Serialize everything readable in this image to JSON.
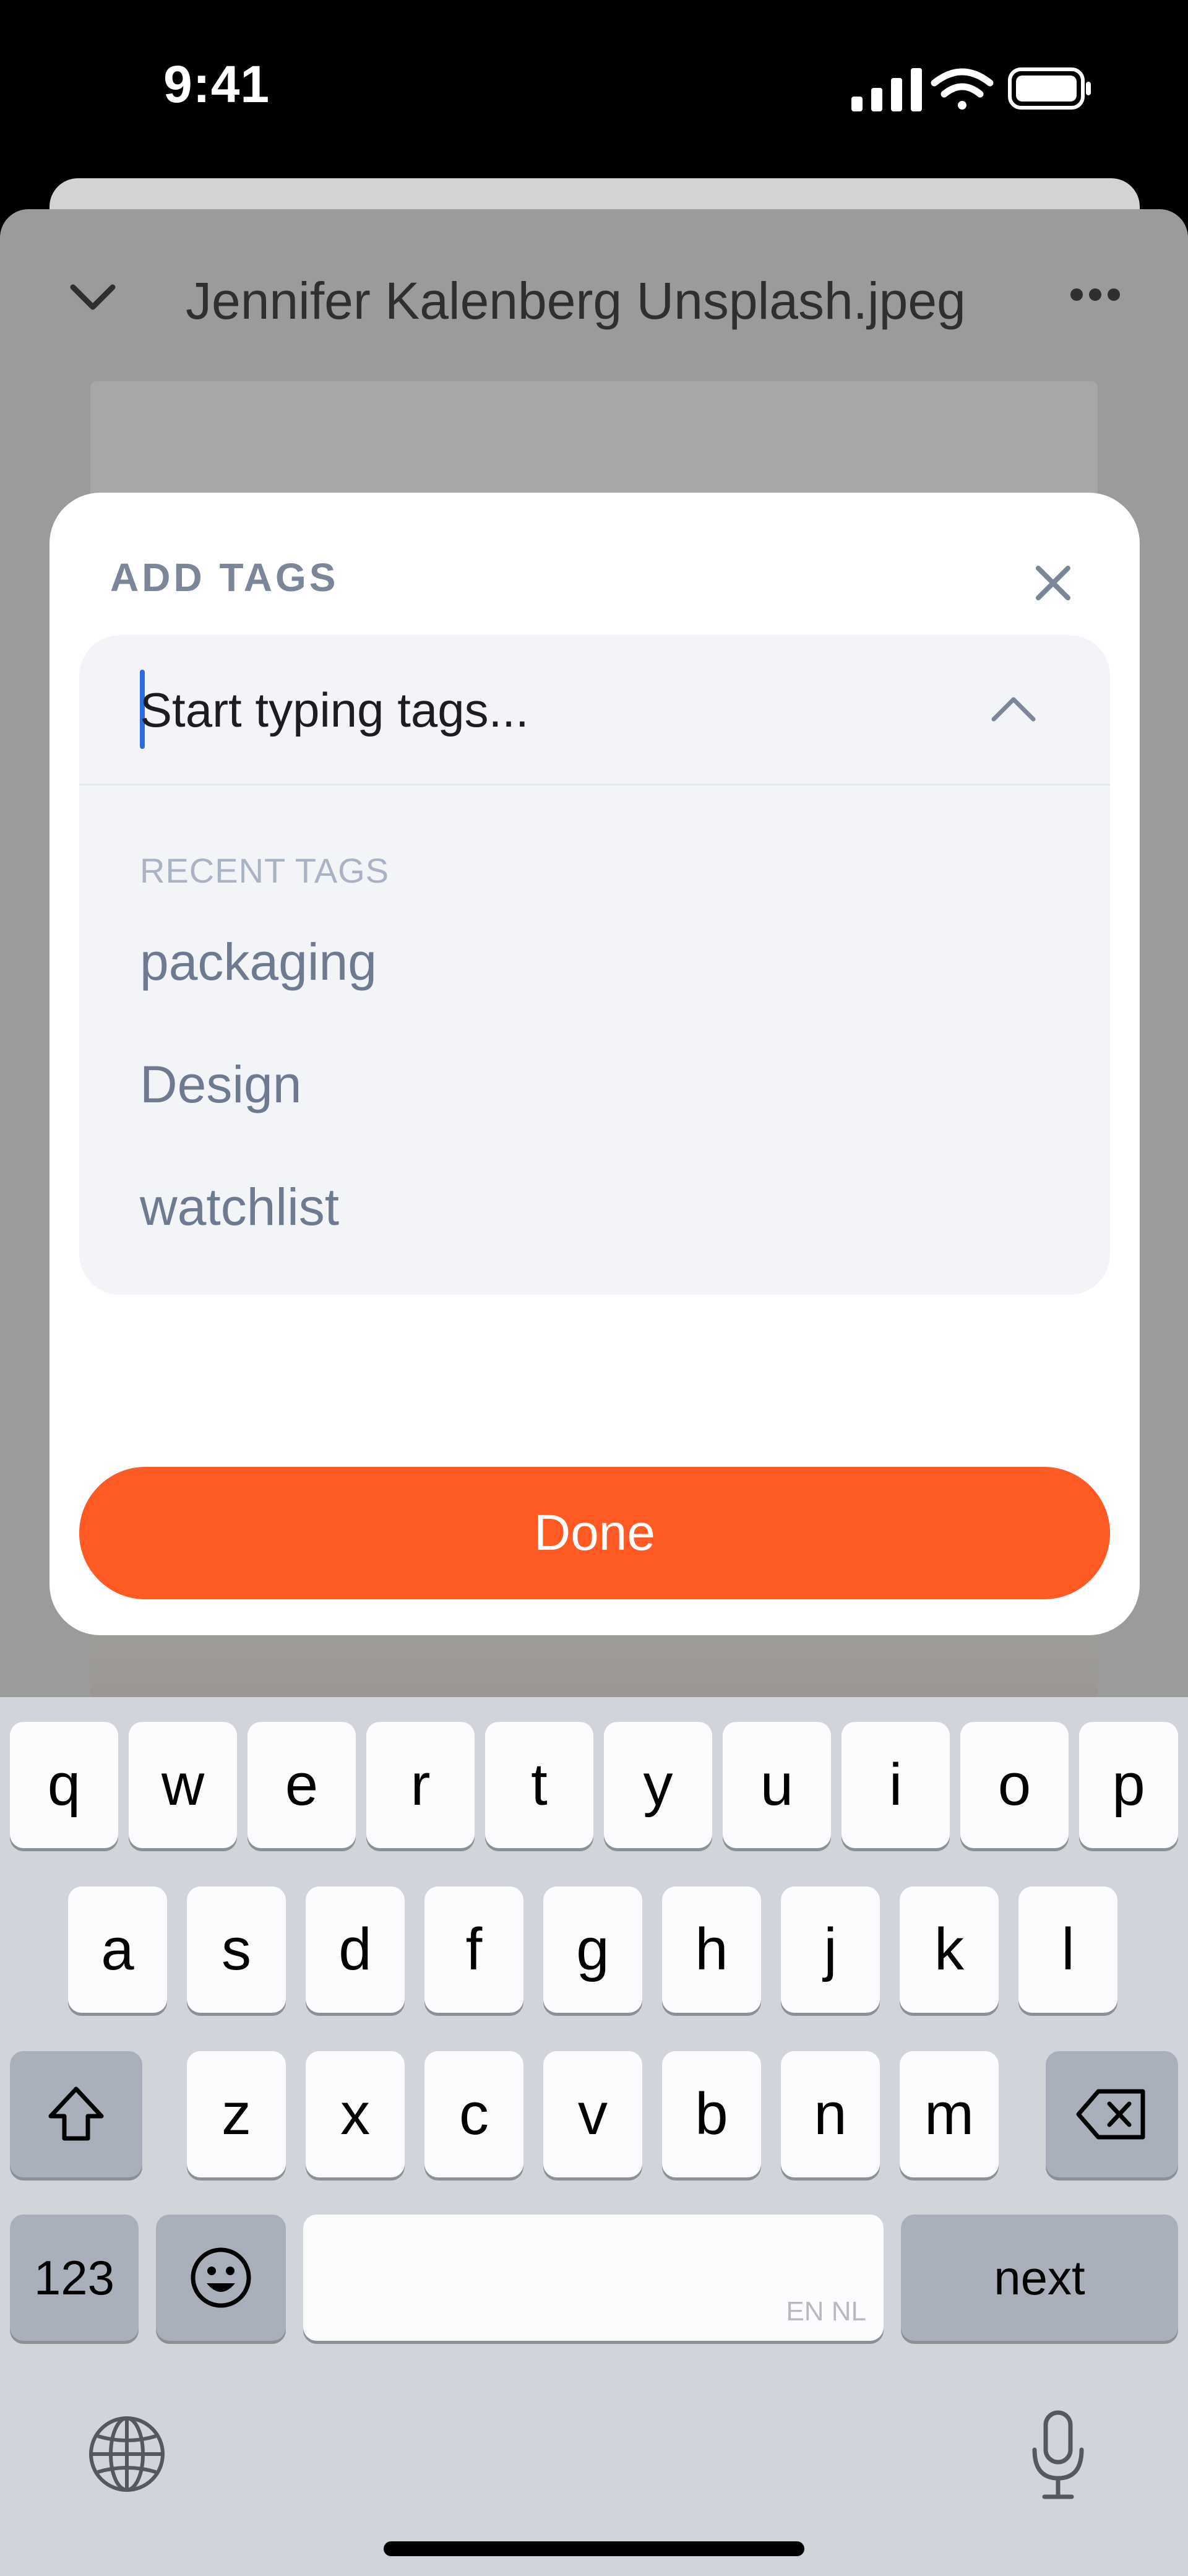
{
  "status_bar": {
    "time": "9:41",
    "signal_icon": "cellular-signal-icon",
    "wifi_icon": "wifi-icon",
    "battery_icon": "battery-icon"
  },
  "sheet": {
    "title": "Jennifer Kalenberg Unsplash.jpeg",
    "collapse_icon": "chevron-down-icon",
    "more_icon": "ellipsis-icon"
  },
  "modal": {
    "title": "ADD TAGS",
    "close_icon": "close-icon",
    "input": {
      "placeholder": "Start typing tags...",
      "value": ""
    },
    "dropdown_icon": "chevron-up-icon",
    "recent_heading": "RECENT TAGS",
    "recent_tags": [
      "packaging",
      "Design",
      "watchlist"
    ],
    "done_label": "Done",
    "accent_color": "#FF5A24"
  },
  "keyboard": {
    "row1": [
      "q",
      "w",
      "e",
      "r",
      "t",
      "y",
      "u",
      "i",
      "o",
      "p"
    ],
    "row2": [
      "a",
      "s",
      "d",
      "f",
      "g",
      "h",
      "j",
      "k",
      "l"
    ],
    "row3": [
      "z",
      "x",
      "c",
      "v",
      "b",
      "n",
      "m"
    ],
    "shift_icon": "shift-icon",
    "delete_icon": "backspace-icon",
    "numbers_label": "123",
    "emoji_icon": "emoji-icon",
    "space_lang_label": "EN NL",
    "return_label": "next",
    "globe_icon": "globe-icon",
    "mic_icon": "microphone-icon"
  }
}
